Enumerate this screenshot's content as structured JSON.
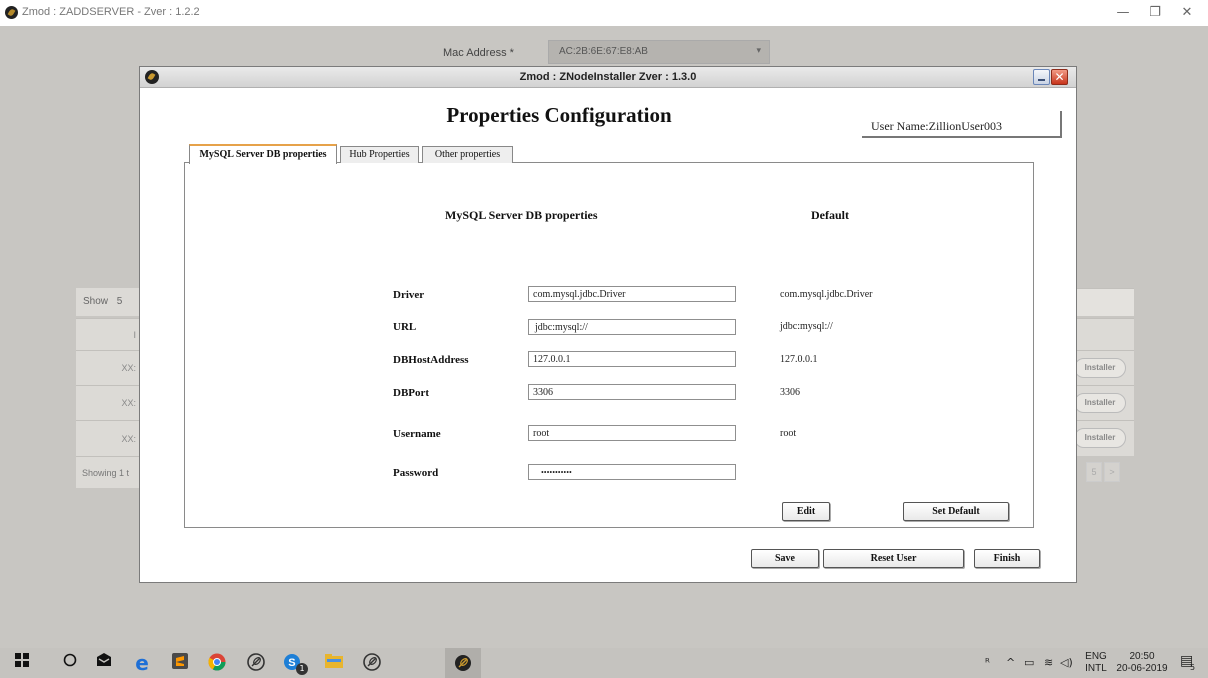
{
  "outer_window": {
    "title": "Zmod : ZADDSERVER - Zver : 1.2.2",
    "controls": {
      "minimize": "—",
      "restore": "❐",
      "close": "✕"
    }
  },
  "background": {
    "mac_label": "Mac Address *",
    "mac_value": "AC:2B:6E:67:E8:AB",
    "caret": "▾",
    "show_label": "Show",
    "show_value": "5",
    "header_cell": "I",
    "rows": [
      "XX:",
      "XX:",
      "XX:"
    ],
    "row_buttons": [
      "Installer",
      "Installer",
      "Installer"
    ],
    "footer_text": "Showing 1 t",
    "pager": [
      "5",
      ">"
    ]
  },
  "dialog": {
    "title": "Zmod : ZNodeInstaller Zver : 1.3.0",
    "close_glyph": "✕",
    "heading": "Properties Configuration",
    "user_name": "User Name:ZillionUser003",
    "tabs": [
      "MySQL Server DB properties",
      "Hub Properties",
      "Other properties"
    ],
    "section_title": "MySQL Server DB properties",
    "default_title": "Default",
    "fields": [
      {
        "label": "Driver",
        "value": "com.mysql.jdbc.Driver",
        "default": "com.mysql.jdbc.Driver"
      },
      {
        "label": "URL",
        "value": "jdbc:mysql://",
        "default": "jdbc:mysql://"
      },
      {
        "label": "DBHostAddress",
        "value": "127.0.0.1",
        "default": "127.0.0.1"
      },
      {
        "label": "DBPort",
        "value": "3306",
        "default": "3306"
      },
      {
        "label": "Username",
        "value": "root",
        "default": "root"
      },
      {
        "label": "Password",
        "value": "•••••••••••",
        "default": ""
      }
    ],
    "panel_buttons": {
      "edit": "Edit",
      "set_default": "Set Default"
    },
    "footer_buttons": {
      "save": "Save",
      "reset_user": "Reset User",
      "finish": "Finish"
    }
  },
  "taskbar": {
    "lang_top": "ENG",
    "lang_bottom": "INTL",
    "time": "20:50",
    "date": "20-06-2019",
    "notification_count": "5",
    "skype_badge": "1"
  }
}
